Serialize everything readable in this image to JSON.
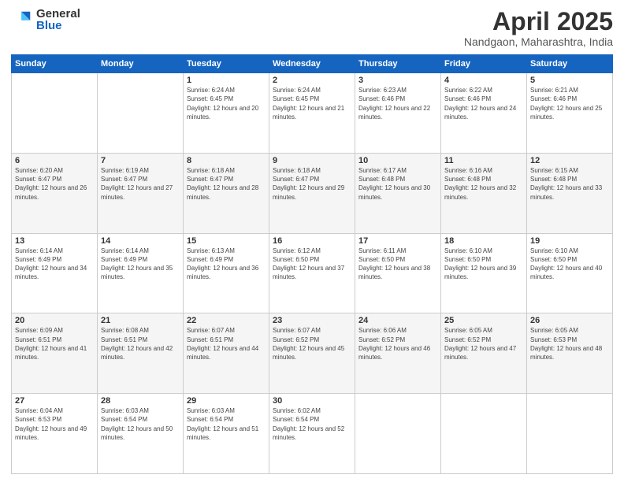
{
  "logo": {
    "general": "General",
    "blue": "Blue"
  },
  "title": {
    "month": "April 2025",
    "location": "Nandgaon, Maharashtra, India"
  },
  "days_of_week": [
    "Sunday",
    "Monday",
    "Tuesday",
    "Wednesday",
    "Thursday",
    "Friday",
    "Saturday"
  ],
  "weeks": [
    [
      {
        "day": "",
        "sunrise": "",
        "sunset": "",
        "daylight": ""
      },
      {
        "day": "",
        "sunrise": "",
        "sunset": "",
        "daylight": ""
      },
      {
        "day": "1",
        "sunrise": "Sunrise: 6:24 AM",
        "sunset": "Sunset: 6:45 PM",
        "daylight": "Daylight: 12 hours and 20 minutes."
      },
      {
        "day": "2",
        "sunrise": "Sunrise: 6:24 AM",
        "sunset": "Sunset: 6:45 PM",
        "daylight": "Daylight: 12 hours and 21 minutes."
      },
      {
        "day": "3",
        "sunrise": "Sunrise: 6:23 AM",
        "sunset": "Sunset: 6:46 PM",
        "daylight": "Daylight: 12 hours and 22 minutes."
      },
      {
        "day": "4",
        "sunrise": "Sunrise: 6:22 AM",
        "sunset": "Sunset: 6:46 PM",
        "daylight": "Daylight: 12 hours and 24 minutes."
      },
      {
        "day": "5",
        "sunrise": "Sunrise: 6:21 AM",
        "sunset": "Sunset: 6:46 PM",
        "daylight": "Daylight: 12 hours and 25 minutes."
      }
    ],
    [
      {
        "day": "6",
        "sunrise": "Sunrise: 6:20 AM",
        "sunset": "Sunset: 6:47 PM",
        "daylight": "Daylight: 12 hours and 26 minutes."
      },
      {
        "day": "7",
        "sunrise": "Sunrise: 6:19 AM",
        "sunset": "Sunset: 6:47 PM",
        "daylight": "Daylight: 12 hours and 27 minutes."
      },
      {
        "day": "8",
        "sunrise": "Sunrise: 6:18 AM",
        "sunset": "Sunset: 6:47 PM",
        "daylight": "Daylight: 12 hours and 28 minutes."
      },
      {
        "day": "9",
        "sunrise": "Sunrise: 6:18 AM",
        "sunset": "Sunset: 6:47 PM",
        "daylight": "Daylight: 12 hours and 29 minutes."
      },
      {
        "day": "10",
        "sunrise": "Sunrise: 6:17 AM",
        "sunset": "Sunset: 6:48 PM",
        "daylight": "Daylight: 12 hours and 30 minutes."
      },
      {
        "day": "11",
        "sunrise": "Sunrise: 6:16 AM",
        "sunset": "Sunset: 6:48 PM",
        "daylight": "Daylight: 12 hours and 32 minutes."
      },
      {
        "day": "12",
        "sunrise": "Sunrise: 6:15 AM",
        "sunset": "Sunset: 6:48 PM",
        "daylight": "Daylight: 12 hours and 33 minutes."
      }
    ],
    [
      {
        "day": "13",
        "sunrise": "Sunrise: 6:14 AM",
        "sunset": "Sunset: 6:49 PM",
        "daylight": "Daylight: 12 hours and 34 minutes."
      },
      {
        "day": "14",
        "sunrise": "Sunrise: 6:14 AM",
        "sunset": "Sunset: 6:49 PM",
        "daylight": "Daylight: 12 hours and 35 minutes."
      },
      {
        "day": "15",
        "sunrise": "Sunrise: 6:13 AM",
        "sunset": "Sunset: 6:49 PM",
        "daylight": "Daylight: 12 hours and 36 minutes."
      },
      {
        "day": "16",
        "sunrise": "Sunrise: 6:12 AM",
        "sunset": "Sunset: 6:50 PM",
        "daylight": "Daylight: 12 hours and 37 minutes."
      },
      {
        "day": "17",
        "sunrise": "Sunrise: 6:11 AM",
        "sunset": "Sunset: 6:50 PM",
        "daylight": "Daylight: 12 hours and 38 minutes."
      },
      {
        "day": "18",
        "sunrise": "Sunrise: 6:10 AM",
        "sunset": "Sunset: 6:50 PM",
        "daylight": "Daylight: 12 hours and 39 minutes."
      },
      {
        "day": "19",
        "sunrise": "Sunrise: 6:10 AM",
        "sunset": "Sunset: 6:50 PM",
        "daylight": "Daylight: 12 hours and 40 minutes."
      }
    ],
    [
      {
        "day": "20",
        "sunrise": "Sunrise: 6:09 AM",
        "sunset": "Sunset: 6:51 PM",
        "daylight": "Daylight: 12 hours and 41 minutes."
      },
      {
        "day": "21",
        "sunrise": "Sunrise: 6:08 AM",
        "sunset": "Sunset: 6:51 PM",
        "daylight": "Daylight: 12 hours and 42 minutes."
      },
      {
        "day": "22",
        "sunrise": "Sunrise: 6:07 AM",
        "sunset": "Sunset: 6:51 PM",
        "daylight": "Daylight: 12 hours and 44 minutes."
      },
      {
        "day": "23",
        "sunrise": "Sunrise: 6:07 AM",
        "sunset": "Sunset: 6:52 PM",
        "daylight": "Daylight: 12 hours and 45 minutes."
      },
      {
        "day": "24",
        "sunrise": "Sunrise: 6:06 AM",
        "sunset": "Sunset: 6:52 PM",
        "daylight": "Daylight: 12 hours and 46 minutes."
      },
      {
        "day": "25",
        "sunrise": "Sunrise: 6:05 AM",
        "sunset": "Sunset: 6:52 PM",
        "daylight": "Daylight: 12 hours and 47 minutes."
      },
      {
        "day": "26",
        "sunrise": "Sunrise: 6:05 AM",
        "sunset": "Sunset: 6:53 PM",
        "daylight": "Daylight: 12 hours and 48 minutes."
      }
    ],
    [
      {
        "day": "27",
        "sunrise": "Sunrise: 6:04 AM",
        "sunset": "Sunset: 6:53 PM",
        "daylight": "Daylight: 12 hours and 49 minutes."
      },
      {
        "day": "28",
        "sunrise": "Sunrise: 6:03 AM",
        "sunset": "Sunset: 6:54 PM",
        "daylight": "Daylight: 12 hours and 50 minutes."
      },
      {
        "day": "29",
        "sunrise": "Sunrise: 6:03 AM",
        "sunset": "Sunset: 6:54 PM",
        "daylight": "Daylight: 12 hours and 51 minutes."
      },
      {
        "day": "30",
        "sunrise": "Sunrise: 6:02 AM",
        "sunset": "Sunset: 6:54 PM",
        "daylight": "Daylight: 12 hours and 52 minutes."
      },
      {
        "day": "",
        "sunrise": "",
        "sunset": "",
        "daylight": ""
      },
      {
        "day": "",
        "sunrise": "",
        "sunset": "",
        "daylight": ""
      },
      {
        "day": "",
        "sunrise": "",
        "sunset": "",
        "daylight": ""
      }
    ]
  ]
}
